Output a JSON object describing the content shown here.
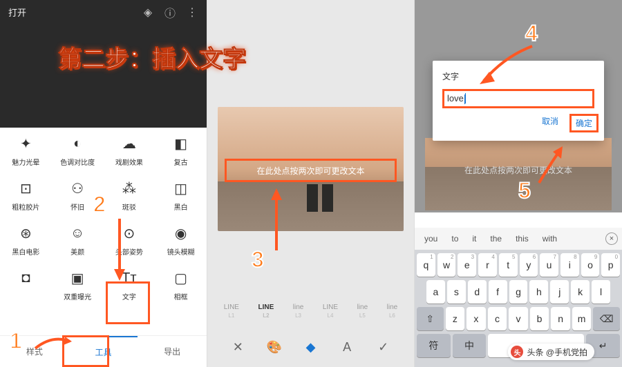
{
  "tutorial": {
    "step_title": "第二步：插入文字",
    "badges": [
      "1",
      "2",
      "3",
      "4",
      "5"
    ],
    "watermark": "头条 @手机党拍"
  },
  "panel1": {
    "header_open": "打开",
    "tools": [
      {
        "icon": "✦",
        "label": "魅力光晕"
      },
      {
        "icon": "◐",
        "label": "色调对比度"
      },
      {
        "icon": "☁",
        "label": "戏剧效果"
      },
      {
        "icon": "◧",
        "label": "复古"
      },
      {
        "icon": "⊡",
        "label": "粗粒胶片"
      },
      {
        "icon": "⚇",
        "label": "怀旧"
      },
      {
        "icon": "⁂",
        "label": "斑驳"
      },
      {
        "icon": "◫",
        "label": "黑白"
      },
      {
        "icon": "⊛",
        "label": "黑白电影"
      },
      {
        "icon": "☺",
        "label": "美颜"
      },
      {
        "icon": "⊙",
        "label": "头部姿势"
      },
      {
        "icon": "◉",
        "label": "镜头模糊"
      },
      {
        "icon": "◘",
        "label": ""
      },
      {
        "icon": "▣",
        "label": "双重曝光"
      },
      {
        "icon": "Tᴛ",
        "label": "文字"
      },
      {
        "icon": "▢",
        "label": "相框"
      }
    ],
    "tabs": {
      "styles": "样式",
      "tools": "工具",
      "export": "导出"
    }
  },
  "panel2": {
    "placeholder_prompt": "在此处点按两次即可更改文本",
    "fonts": [
      {
        "name": "LINE",
        "size": "L1"
      },
      {
        "name": "LINE",
        "size": "L2"
      },
      {
        "name": "line",
        "size": "L3"
      },
      {
        "name": "LINE",
        "size": "L4"
      },
      {
        "name": "line",
        "size": "L5"
      },
      {
        "name": "line",
        "size": "L6"
      }
    ]
  },
  "panel3": {
    "bg_prompt": "在此处点按两次即可更改文本",
    "dialog": {
      "title": "文字",
      "input": "love",
      "cancel": "取消",
      "ok": "确定"
    },
    "suggestions": [
      "you",
      "to",
      "it",
      "the",
      "this",
      "with"
    ],
    "keyboard": {
      "row1": [
        {
          "k": "q",
          "n": "1"
        },
        {
          "k": "w",
          "n": "2"
        },
        {
          "k": "e",
          "n": "3"
        },
        {
          "k": "r",
          "n": "4"
        },
        {
          "k": "t",
          "n": "5"
        },
        {
          "k": "y",
          "n": "6"
        },
        {
          "k": "u",
          "n": "7"
        },
        {
          "k": "i",
          "n": "8"
        },
        {
          "k": "o",
          "n": "9"
        },
        {
          "k": "p",
          "n": "0"
        }
      ],
      "row2": [
        {
          "k": "a"
        },
        {
          "k": "s"
        },
        {
          "k": "d"
        },
        {
          "k": "f"
        },
        {
          "k": "g"
        },
        {
          "k": "h"
        },
        {
          "k": "j"
        },
        {
          "k": "k"
        },
        {
          "k": "l"
        }
      ],
      "row3_shift": "⇧",
      "row3": [
        {
          "k": "z"
        },
        {
          "k": "x"
        },
        {
          "k": "c"
        },
        {
          "k": "v"
        },
        {
          "k": "b"
        },
        {
          "k": "n"
        },
        {
          "k": "m"
        }
      ],
      "row3_del": "⌫",
      "row4": {
        "sym": "符",
        "lang": "中",
        "space": "",
        "enter": "↵"
      }
    }
  }
}
